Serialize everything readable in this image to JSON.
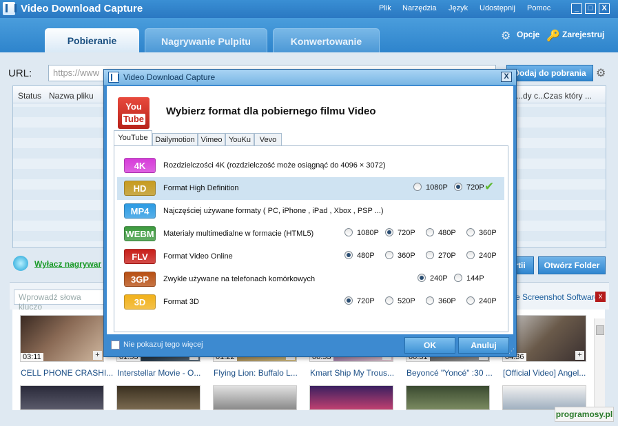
{
  "app": {
    "title": "Video Download Capture",
    "menu": [
      "Plik",
      "Narzędzia",
      "Język",
      "Udostępnij",
      "Pomoc"
    ],
    "window_buttons": [
      "_",
      "□",
      "X"
    ]
  },
  "tabs": [
    {
      "label": "Pobieranie",
      "active": true
    },
    {
      "label": "Nagrywanie Pulpitu",
      "active": false
    },
    {
      "label": "Konwertowanie",
      "active": false
    }
  ],
  "header_links": {
    "options": "Opcje",
    "register": "Zarejestruj"
  },
  "url_bar": {
    "label": "URL:",
    "value": "https://www",
    "add_button": "Dodaj do pobrania"
  },
  "list_columns": [
    "Status",
    "Nazwa pliku",
    "...dy c...",
    "Czas który ..."
  ],
  "turnoff_link": "Wyłacz nagrywar",
  "buttons": {
    "partial": "rtii",
    "open_folder": "Otwórz Folder"
  },
  "search": {
    "placeholder": "Wprowadź słowa kluczo",
    "promo_link": "e Screenshot Software",
    "close": "x"
  },
  "videos": [
    {
      "duration": "03:11",
      "title": "CELL PHONE CRASHI..."
    },
    {
      "duration": "01:53",
      "title": "Interstellar Movie - O..."
    },
    {
      "duration": "01:22",
      "title": "Flying Lion: Buffalo L..."
    },
    {
      "duration": "00:53",
      "title": "Kmart Ship My Trous..."
    },
    {
      "duration": "00:31",
      "title": "Beyoncé \"Yoncé\" :30 ..."
    },
    {
      "duration": "04:36",
      "title": "[Official Video] Angel..."
    }
  ],
  "watermark": "programosy.pl",
  "dialog": {
    "title": "Video Download Capture",
    "close": "X",
    "logo_text": {
      "line1": "You",
      "line2": "Tube"
    },
    "heading": "Wybierz format dla pobiernego filmu Video",
    "site_tabs": [
      "YouTube",
      "Dailymotion",
      "Vimeo",
      "YouKu",
      "Vevo"
    ],
    "formats": [
      {
        "badge": "4K",
        "color": "#d63bd9",
        "desc": "Rozdzielczości 4K (rozdzielczość może osiągnąć do 4096 × 3072)",
        "options": [],
        "selected": ""
      },
      {
        "badge": "HD",
        "color": "#c79b1f",
        "desc": "Format High Definition",
        "options": [
          "1080P",
          "720P"
        ],
        "selected": "720P",
        "highlighted": true
      },
      {
        "badge": "MP4",
        "color": "#2c9be3",
        "desc": "Najczęściej używane formaty ( PC, iPhone , iPad , Xbox , PSP ...)",
        "options": [],
        "selected": ""
      },
      {
        "badge": "WEBM",
        "color": "#3c9a3e",
        "desc": "Materiały multimedialne w formacie (HTML5)",
        "options": [
          "1080P",
          "720P",
          "480P",
          "360P"
        ],
        "selected": "720P"
      },
      {
        "badge": "FLV",
        "color": "#c81f1a",
        "desc": "Format Video Online",
        "options": [
          "480P",
          "360P",
          "270P",
          "240P"
        ],
        "selected": "480P"
      },
      {
        "badge": "3GP",
        "color": "#b85014",
        "desc": "Zwykle używane na telefonach komórkowych",
        "options": [
          "240P",
          "144P"
        ],
        "selected": "240P"
      },
      {
        "badge": "3D",
        "color": "#f1b11b",
        "desc": "Format 3D",
        "options": [
          "720P",
          "520P",
          "360P",
          "240P"
        ],
        "selected": "720P"
      }
    ],
    "dont_show": "Nie pokazuj tego więcej",
    "ok": "OK",
    "cancel": "Anuluj"
  }
}
